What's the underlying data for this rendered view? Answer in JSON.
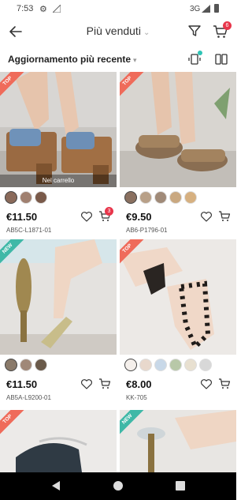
{
  "status_bar": {
    "time": "7:53",
    "network": "3G"
  },
  "header": {
    "title": "Più venduti",
    "cart_count": "6"
  },
  "sortbar": {
    "sort_label": "Aggiornamento più recente"
  },
  "products": [
    {
      "tag": "TOP",
      "price": "€11.50",
      "code": "AB5C-L1871-01",
      "in_cart_label": "Nel carrello",
      "cart_count": "3",
      "swatches": [
        "#8a6a5a",
        "#a08070",
        "#7a5a4a"
      ]
    },
    {
      "tag": "TOP",
      "price": "€9.50",
      "code": "AB6-P1796-01",
      "swatches": [
        "#8a7060",
        "#b8a088",
        "#a08a78",
        "#c9a880",
        "#d6b080"
      ]
    },
    {
      "tag": "NEW",
      "price": "€11.50",
      "code": "AB5A-L9200-01",
      "swatches": [
        "#8a7a6a",
        "#a08878",
        "#6a5a4a"
      ]
    },
    {
      "tag": "TOP",
      "price": "€8.00",
      "code": "KK-705",
      "swatches": [
        "#f5f0ec",
        "#e8d8cc",
        "#c8d8e8",
        "#b8c8a8",
        "#e8e0d0",
        "#d8d8d8"
      ]
    },
    {
      "tag": "TOP"
    },
    {
      "tag": "NEW"
    }
  ],
  "colors": {
    "accent": "#e8364b",
    "top_tag": "#ef6b5a",
    "new_tag": "#3fb8a7"
  }
}
